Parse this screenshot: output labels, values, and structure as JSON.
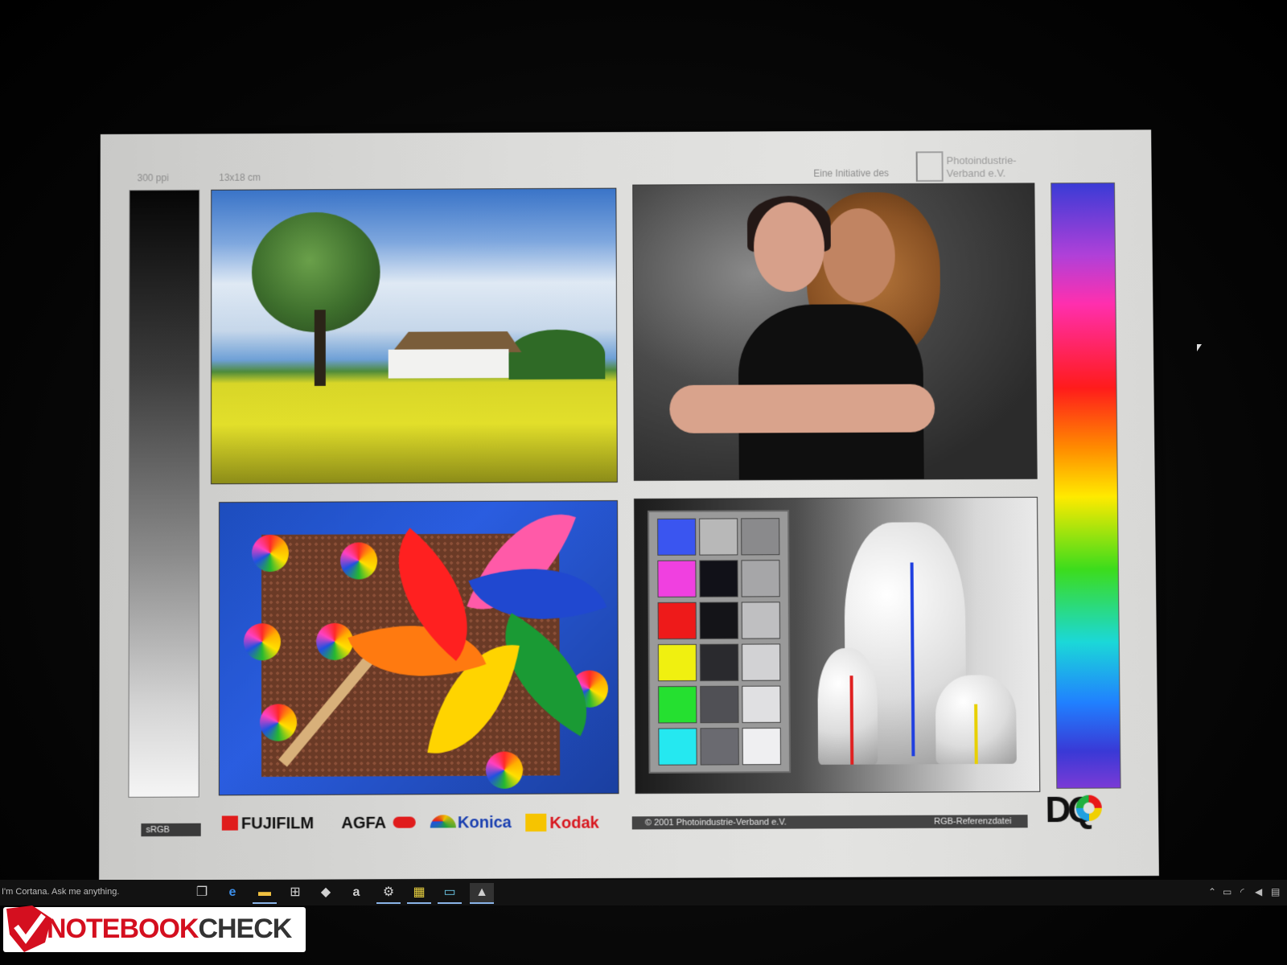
{
  "chart": {
    "resolution": "300 ppi",
    "size": "13x18 cm",
    "initiative": "Eine Initiative des",
    "organization_line1": "Photoindustrie-",
    "organization_line2": "Verband e.V.",
    "color_space": "sRGB",
    "brands": [
      "FUJIFILM",
      "AGFA",
      "Konica",
      "Kodak"
    ],
    "copyright": "© 2001  Photoindustrie-Verband e.V.",
    "file_label": "RGB-Referenzdatei",
    "dq_logo": "DQ"
  },
  "swatches": {
    "column1": [
      "#3a55f0",
      "#f040e0",
      "#ee1a1a",
      "#f0f010",
      "#25e030",
      "#25e8f0"
    ],
    "column2": [
      "#b8b8b8",
      "#111118",
      "#141418",
      "#2a2a2e",
      "#505055",
      "#6a6a70"
    ],
    "column3": [
      "#8a8a8c",
      "#a6a6a8",
      "#bfbfc1",
      "#d2d2d4",
      "#e0e0e2",
      "#efeff1"
    ]
  },
  "taskbar": {
    "search_placeholder": "I'm Cortana. Ask me anything.",
    "icons": [
      "task-view-icon",
      "edge-icon",
      "file-explorer-icon",
      "store-icon",
      "dropbox-icon",
      "amazon-icon",
      "steam-icon",
      "app-icon",
      "monitor-app-icon",
      "photos-icon"
    ],
    "tray_icons": [
      "chevron-up-icon",
      "battery-icon",
      "wifi-icon",
      "volume-icon",
      "notifications-icon"
    ]
  },
  "watermark": {
    "brand_part1": "NOTEBOOK",
    "brand_part2": "CHECK"
  },
  "colors": {
    "brand_red": "#d40f1f",
    "taskbar_bg": "#121212"
  }
}
